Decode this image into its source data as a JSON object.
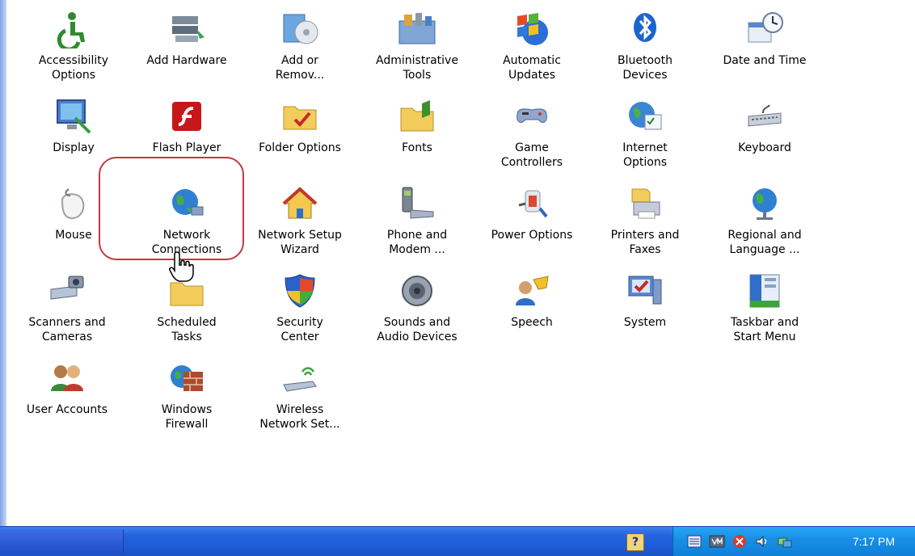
{
  "control_panel": {
    "items": [
      {
        "label": "Accessibility\nOptions",
        "icon": "accessibility-icon"
      },
      {
        "label": "Add Hardware",
        "icon": "add-hardware-icon"
      },
      {
        "label": "Add or\nRemov...",
        "icon": "add-remove-programs-icon"
      },
      {
        "label": "Administrative\nTools",
        "icon": "administrative-tools-icon"
      },
      {
        "label": "Automatic\nUpdates",
        "icon": "automatic-updates-icon"
      },
      {
        "label": "Bluetooth\nDevices",
        "icon": "bluetooth-icon"
      },
      {
        "label": "Date and Time",
        "icon": "date-time-icon"
      },
      {
        "label": "Display",
        "icon": "display-icon"
      },
      {
        "label": "Flash Player",
        "icon": "flash-player-icon"
      },
      {
        "label": "Folder Options",
        "icon": "folder-options-icon"
      },
      {
        "label": "Fonts",
        "icon": "fonts-icon"
      },
      {
        "label": "Game\nControllers",
        "icon": "game-controllers-icon"
      },
      {
        "label": "Internet\nOptions",
        "icon": "internet-options-icon"
      },
      {
        "label": "Keyboard",
        "icon": "keyboard-icon"
      },
      {
        "label": "Mouse",
        "icon": "mouse-icon"
      },
      {
        "label": "Network\nConnections",
        "icon": "network-connections-icon"
      },
      {
        "label": "Network Setup\nWizard",
        "icon": "network-setup-wizard-icon"
      },
      {
        "label": "Phone and\nModem ...",
        "icon": "phone-modem-icon"
      },
      {
        "label": "Power Options",
        "icon": "power-options-icon"
      },
      {
        "label": "Printers and\nFaxes",
        "icon": "printers-faxes-icon"
      },
      {
        "label": "Regional and\nLanguage ...",
        "icon": "regional-language-icon"
      },
      {
        "label": "Scanners and\nCameras",
        "icon": "scanners-cameras-icon"
      },
      {
        "label": "Scheduled\nTasks",
        "icon": "scheduled-tasks-icon"
      },
      {
        "label": "Security\nCenter",
        "icon": "security-center-icon"
      },
      {
        "label": "Sounds and\nAudio Devices",
        "icon": "sounds-audio-icon"
      },
      {
        "label": "Speech",
        "icon": "speech-icon"
      },
      {
        "label": "System",
        "icon": "system-icon"
      },
      {
        "label": "Taskbar and\nStart Menu",
        "icon": "taskbar-start-menu-icon"
      },
      {
        "label": "User Accounts",
        "icon": "user-accounts-icon"
      },
      {
        "label": "Windows\nFirewall",
        "icon": "windows-firewall-icon"
      },
      {
        "label": "Wireless\nNetwork Set...",
        "icon": "wireless-network-setup-icon"
      }
    ]
  },
  "taskbar": {
    "clock": "7:17 PM",
    "help_glyph": "?"
  },
  "colors": {
    "taskbar_blue": "#2463de",
    "tray_blue": "#1890e6",
    "highlight_red": "#c2393e"
  }
}
